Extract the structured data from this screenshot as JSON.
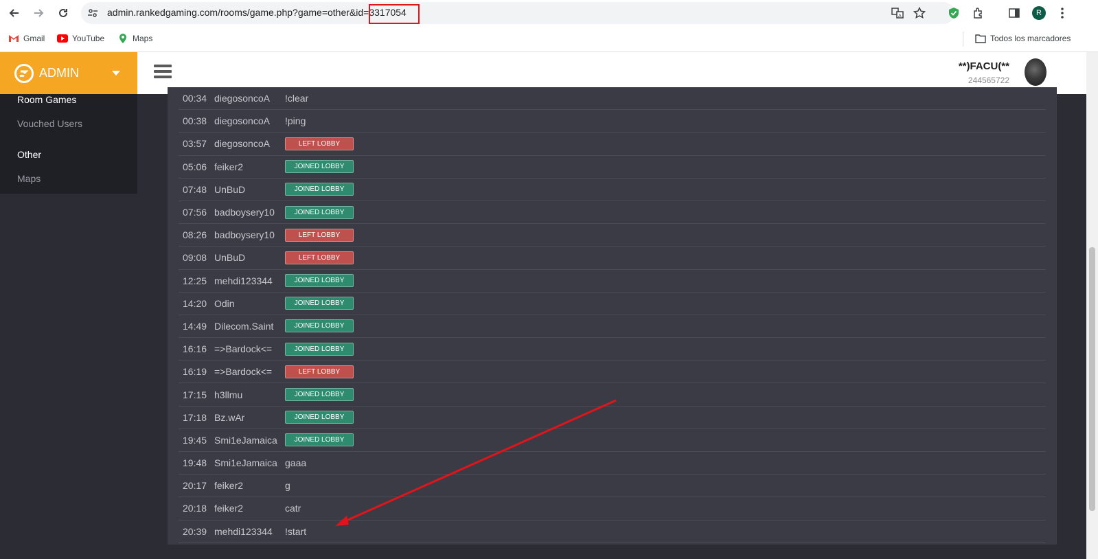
{
  "browser": {
    "url": "admin.rankedgaming.com/rooms/game.php?game=other&id=3317054",
    "profile_initial": "R",
    "bookmarks": [
      {
        "label": "Gmail",
        "icon": "gmail-icon"
      },
      {
        "label": "YouTube",
        "icon": "youtube-icon"
      },
      {
        "label": "Maps",
        "icon": "maps-icon"
      }
    ],
    "all_bookmarks_label": "Todos los marcadores"
  },
  "brand": {
    "title": "ADMIN",
    "color": "#f5a623"
  },
  "user": {
    "name": "**)FACU(**",
    "id": "244565722"
  },
  "sidebar": {
    "items": [
      {
        "label": "Room Games",
        "style": "active"
      },
      {
        "label": "Vouched Users",
        "style": "normal"
      },
      {
        "label": "Other",
        "style": "heading"
      },
      {
        "label": "Maps",
        "style": "normal"
      }
    ]
  },
  "chat": {
    "rows": [
      {
        "time": "00:34",
        "user": "diegosoncoA",
        "message": "!clear"
      },
      {
        "time": "00:38",
        "user": "diegosoncoA",
        "message": "!ping"
      },
      {
        "time": "03:57",
        "user": "diegosoncoA",
        "badge": "LEFT LOBBY",
        "badge_type": "left"
      },
      {
        "time": "05:06",
        "user": "feiker2",
        "badge": "JOINED LOBBY",
        "badge_type": "joined"
      },
      {
        "time": "07:48",
        "user": "UnBuD",
        "badge": "JOINED LOBBY",
        "badge_type": "joined"
      },
      {
        "time": "07:56",
        "user": "badboysery10",
        "badge": "JOINED LOBBY",
        "badge_type": "joined"
      },
      {
        "time": "08:26",
        "user": "badboysery10",
        "badge": "LEFT LOBBY",
        "badge_type": "left"
      },
      {
        "time": "09:08",
        "user": "UnBuD",
        "badge": "LEFT LOBBY",
        "badge_type": "left"
      },
      {
        "time": "12:25",
        "user": "mehdi123344",
        "badge": "JOINED LOBBY",
        "badge_type": "joined"
      },
      {
        "time": "14:20",
        "user": "Odin",
        "badge": "JOINED LOBBY",
        "badge_type": "joined"
      },
      {
        "time": "14:49",
        "user": "Dilecom.Saint",
        "badge": "JOINED LOBBY",
        "badge_type": "joined"
      },
      {
        "time": "16:16",
        "user": "=>Bardock<=",
        "badge": "JOINED LOBBY",
        "badge_type": "joined"
      },
      {
        "time": "16:19",
        "user": "=>Bardock<=",
        "badge": "LEFT LOBBY",
        "badge_type": "left"
      },
      {
        "time": "17:15",
        "user": "h3llmu",
        "badge": "JOINED LOBBY",
        "badge_type": "joined"
      },
      {
        "time": "17:18",
        "user": "Bz.wAr",
        "badge": "JOINED LOBBY",
        "badge_type": "joined"
      },
      {
        "time": "19:45",
        "user": "Smi1eJamaica",
        "badge": "JOINED LOBBY",
        "badge_type": "joined"
      },
      {
        "time": "19:48",
        "user": "Smi1eJamaica",
        "message": "gaaa"
      },
      {
        "time": "20:17",
        "user": "feiker2",
        "message": "g"
      },
      {
        "time": "20:18",
        "user": "feiker2",
        "message": "catr"
      },
      {
        "time": "20:39",
        "user": "mehdi123344",
        "message": "!start"
      }
    ]
  },
  "colors": {
    "left_badge": "#c0504d",
    "joined_badge": "#2e8b6e",
    "annotation": "#e0141a"
  }
}
